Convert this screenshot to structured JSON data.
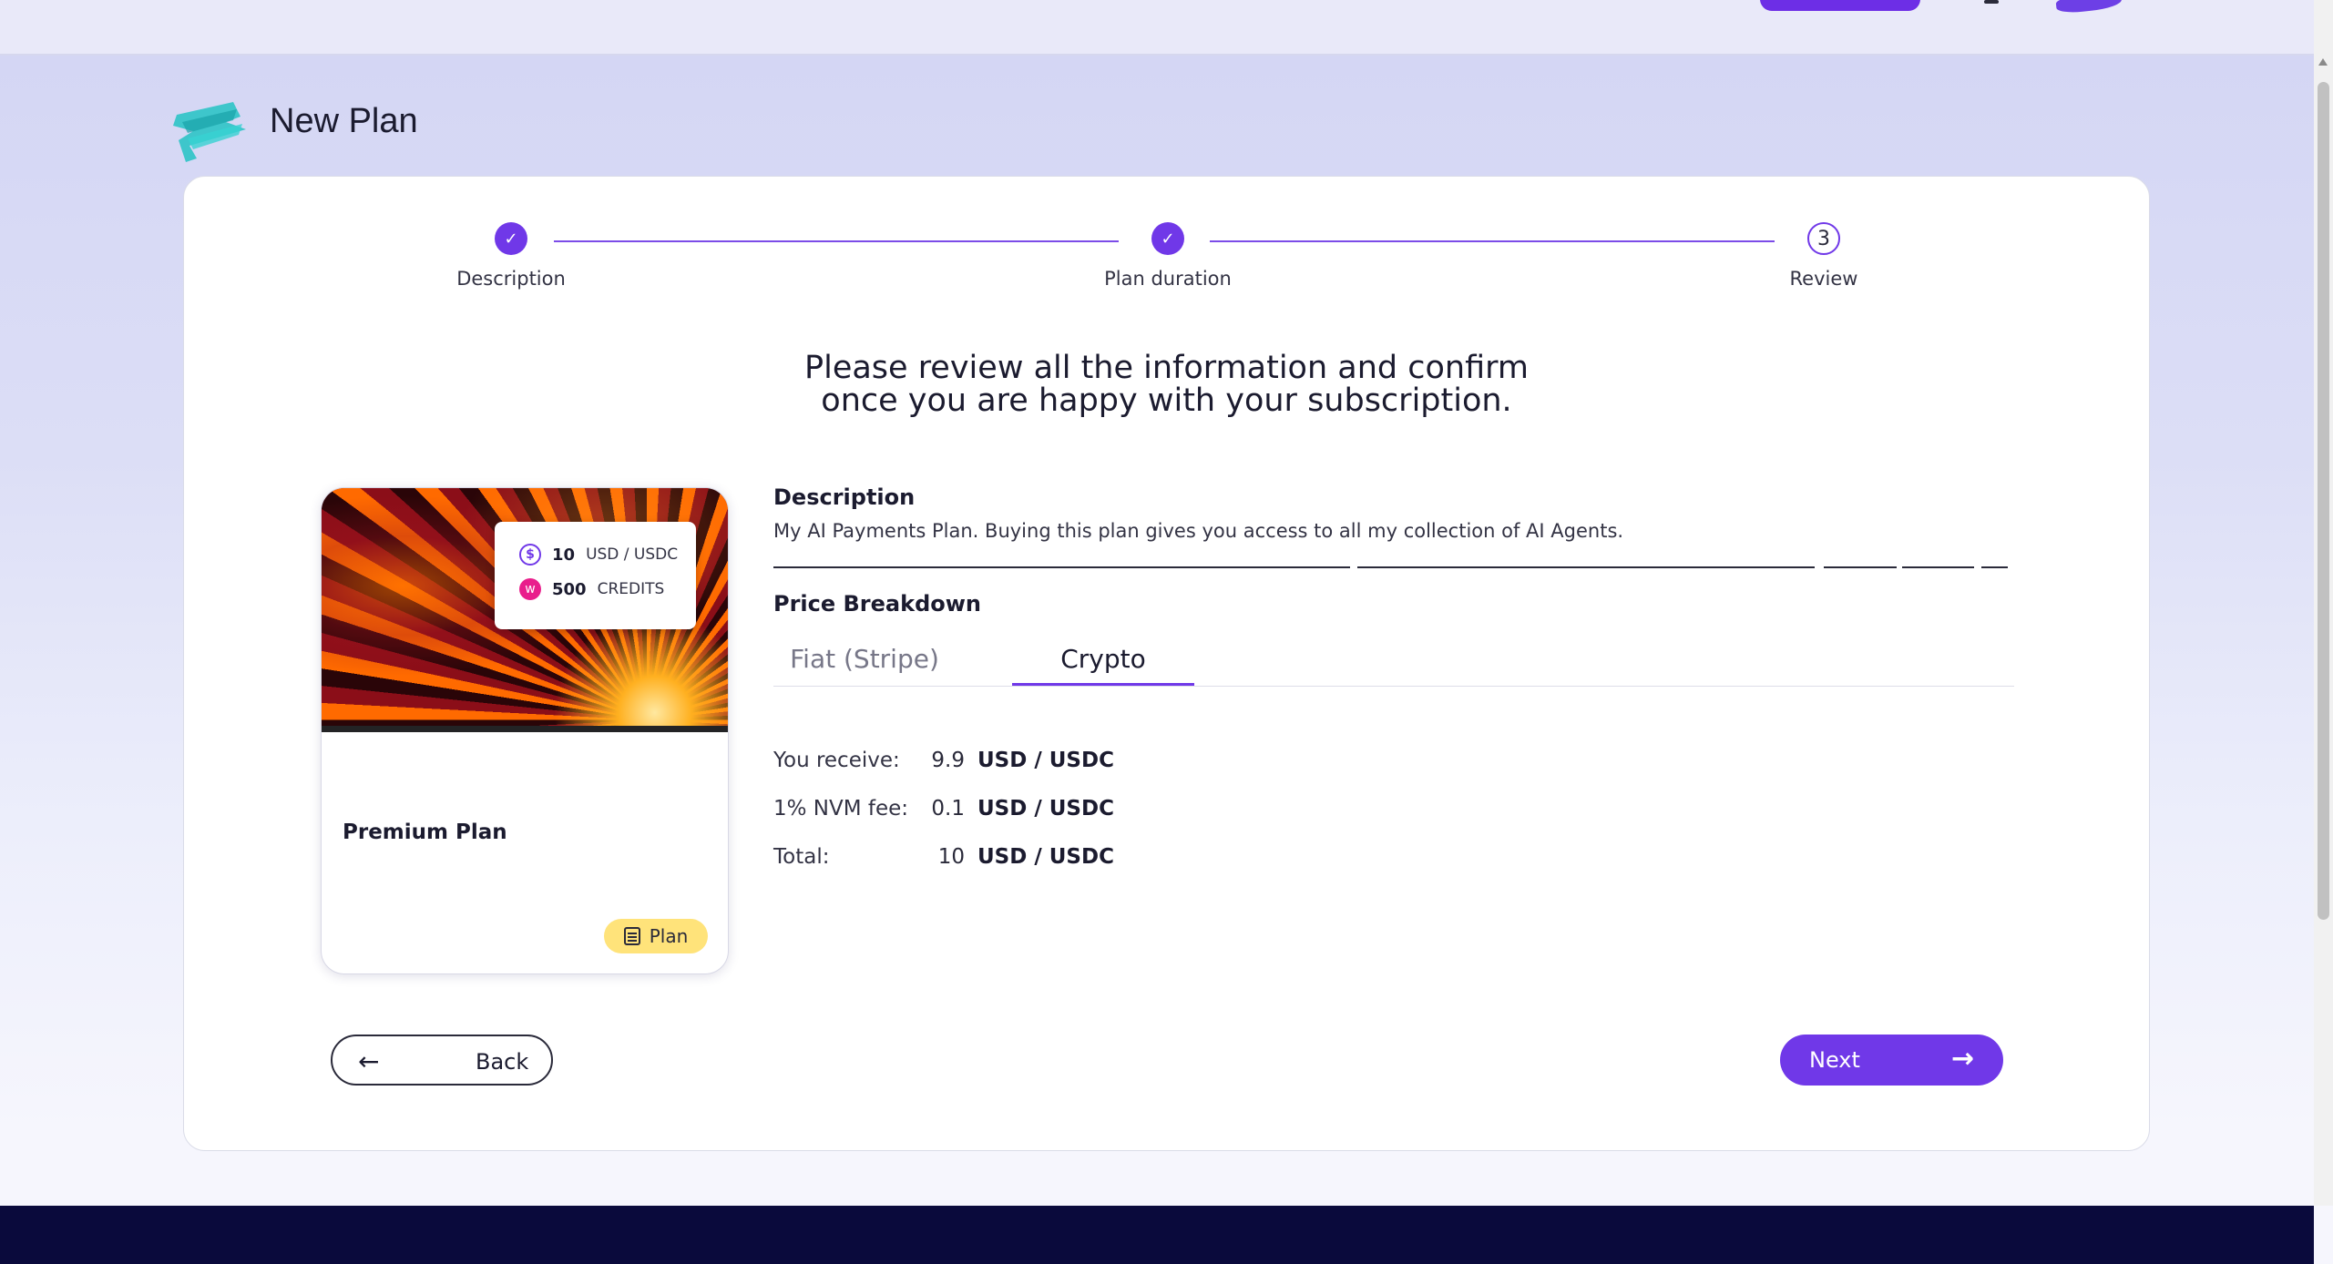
{
  "page": {
    "title": "New Plan"
  },
  "stepper": {
    "steps": [
      {
        "label": "Description",
        "state": "done",
        "marker": "✓"
      },
      {
        "label": "Plan duration",
        "state": "done",
        "marker": "✓"
      },
      {
        "label": "Review",
        "state": "current",
        "marker": "3"
      }
    ]
  },
  "review": {
    "heading_line1": "Please review all the information and confirm",
    "heading_line2": "once you are happy with your subscription."
  },
  "plan_card": {
    "price_value": "10",
    "price_unit": "USD / USDC",
    "credits_value": "500",
    "credits_unit": "CREDITS",
    "name": "Premium Plan",
    "badge": "Plan"
  },
  "description": {
    "title": "Description",
    "text": "My AI Payments Plan. Buying this plan gives you access to all my collection of AI Agents."
  },
  "price_breakdown": {
    "title": "Price Breakdown",
    "tabs": [
      {
        "label": "Fiat (Stripe)",
        "active": false
      },
      {
        "label": "Crypto",
        "active": true
      }
    ],
    "rows": [
      {
        "label": "You receive:",
        "value": "9.9",
        "unit": "USD / USDC"
      },
      {
        "label": "1% NVM fee:",
        "value": "0.1",
        "unit": "USD / USDC"
      },
      {
        "label": "Total:",
        "value": "10",
        "unit": "USD / USDC"
      }
    ]
  },
  "buttons": {
    "back": "Back",
    "next": "Next"
  },
  "colors": {
    "accent": "#7038e8",
    "badge": "#ffe37a",
    "footer": "#0a0a3c"
  }
}
